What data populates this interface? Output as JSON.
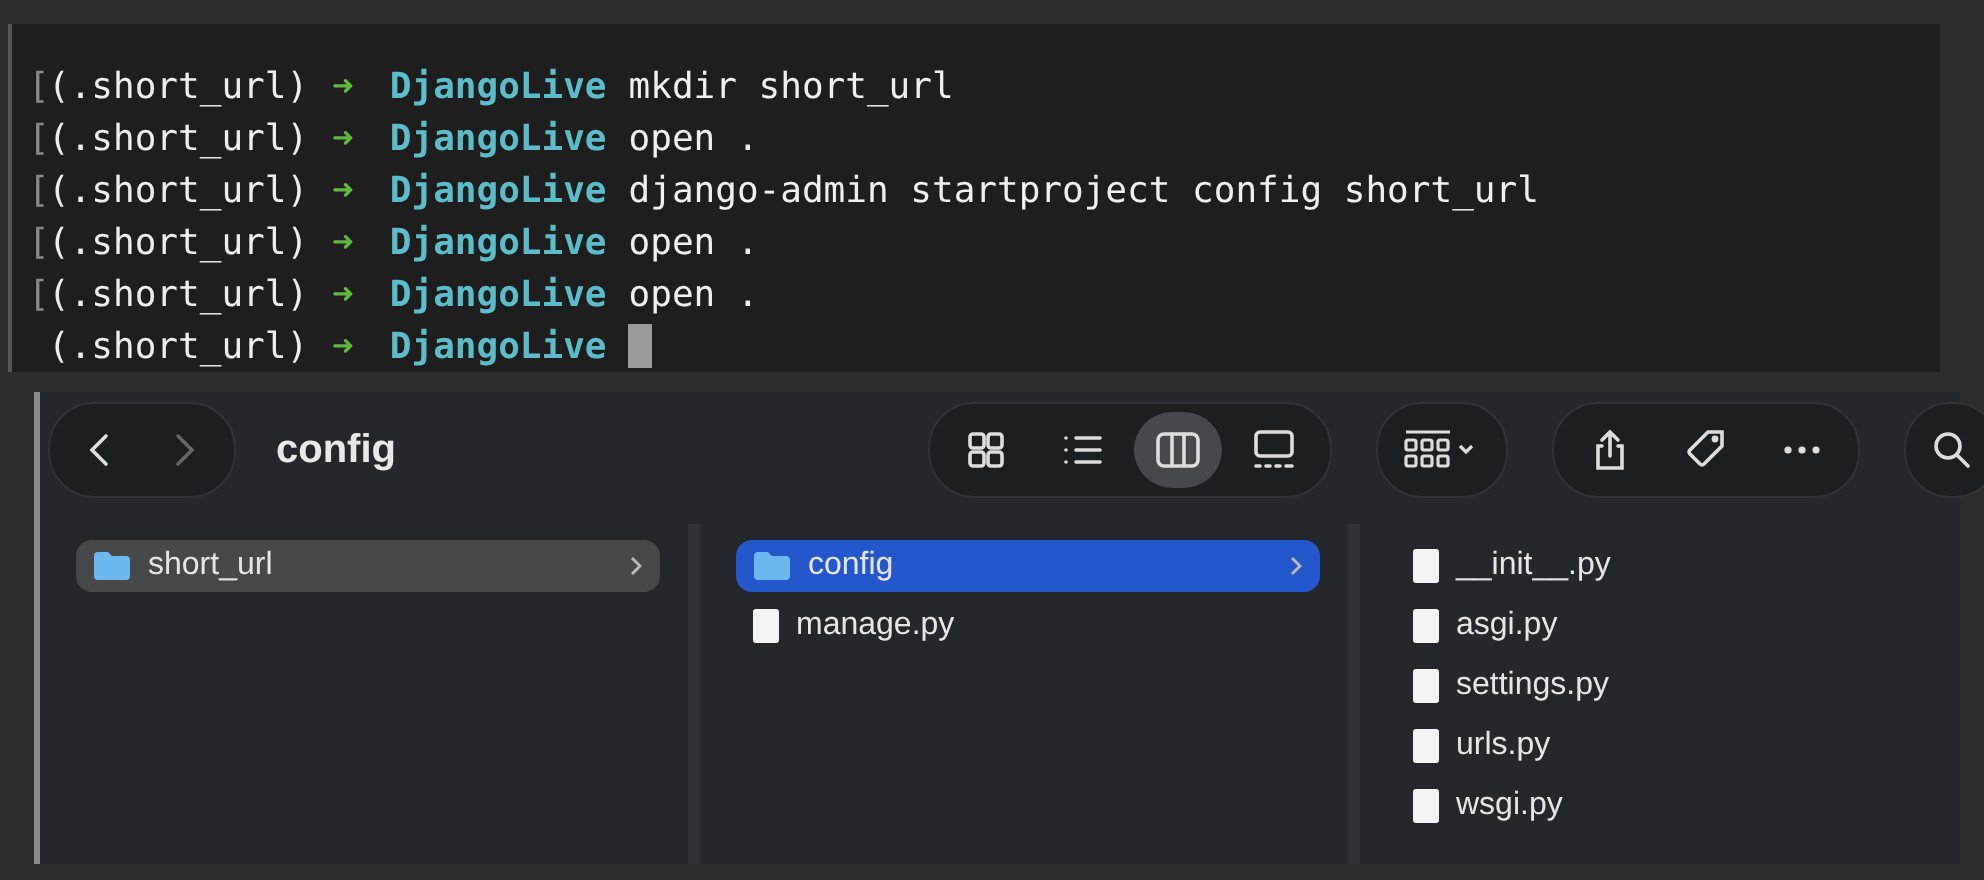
{
  "terminal": {
    "lines": [
      {
        "marker": "[",
        "env": "(.short_url)",
        "arrow": "➜",
        "dir": "DjangoLive",
        "command": "mkdir short_url",
        "cursor": false
      },
      {
        "marker": "[",
        "env": "(.short_url)",
        "arrow": "➜",
        "dir": "DjangoLive",
        "command": "open .",
        "cursor": false
      },
      {
        "marker": "[",
        "env": "(.short_url)",
        "arrow": "➜",
        "dir": "DjangoLive",
        "command": "django-admin startproject config short_url",
        "cursor": false
      },
      {
        "marker": "[",
        "env": "(.short_url)",
        "arrow": "➜",
        "dir": "DjangoLive",
        "command": "open .",
        "cursor": false
      },
      {
        "marker": "[",
        "env": "(.short_url)",
        "arrow": "➜",
        "dir": "DjangoLive",
        "command": "open .",
        "cursor": false
      },
      {
        "env": "(.short_url)",
        "arrow": "➜",
        "dir": "DjangoLive",
        "cursor": true
      }
    ]
  },
  "finder": {
    "back": {
      "disabled": false
    },
    "forward": {
      "disabled": true
    },
    "title": "config",
    "view_modes": [
      {
        "kind": "icons",
        "selected": false
      },
      {
        "kind": "list",
        "selected": false
      },
      {
        "kind": "columns",
        "selected": true
      },
      {
        "kind": "gallery",
        "selected": false
      }
    ],
    "columns": [
      {
        "focused": false,
        "items": [
          {
            "kind": "folder",
            "name": "short_url",
            "selected": true
          }
        ]
      },
      {
        "focused": true,
        "items": [
          {
            "kind": "folder",
            "name": "config",
            "selected": true
          },
          {
            "kind": "file",
            "name": "manage.py",
            "selected": false
          }
        ]
      },
      {
        "items": [
          {
            "kind": "file",
            "name": "__init__.py",
            "selected": false
          },
          {
            "kind": "file",
            "name": "asgi.py",
            "selected": false
          },
          {
            "kind": "file",
            "name": "settings.py",
            "selected": false
          },
          {
            "kind": "file",
            "name": "urls.py",
            "selected": false
          },
          {
            "kind": "file",
            "name": "wsgi.py",
            "selected": false
          }
        ]
      }
    ]
  }
}
